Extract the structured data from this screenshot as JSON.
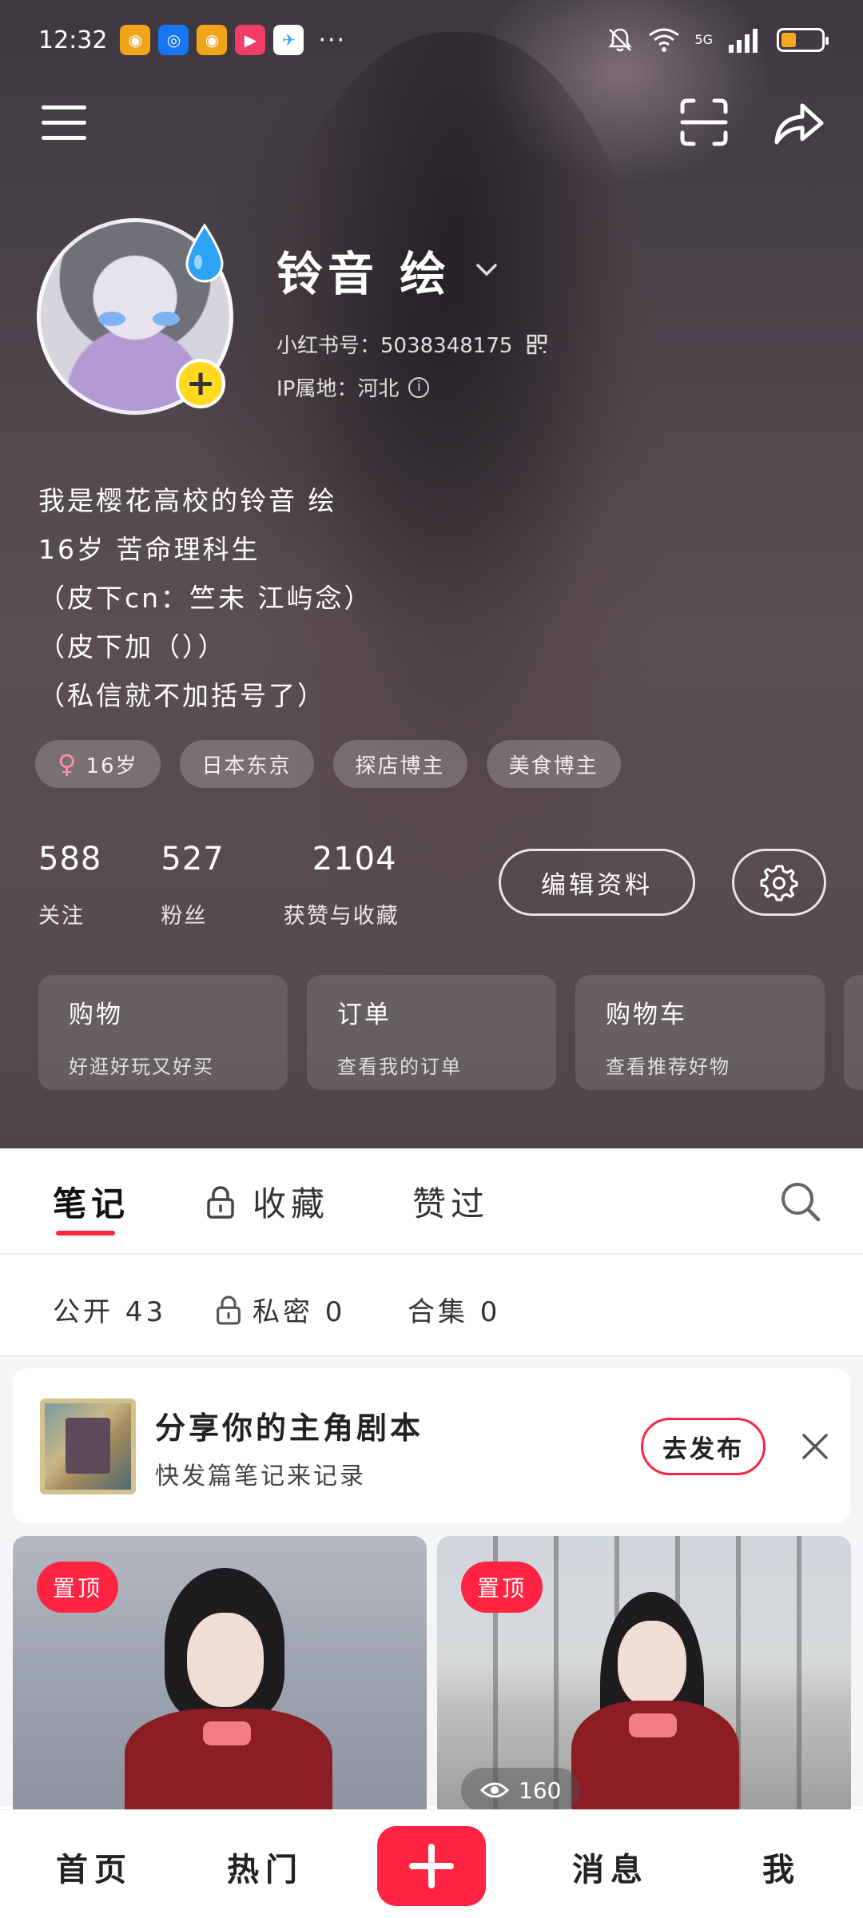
{
  "status_bar": {
    "time": "12:32",
    "more": "···",
    "network": "5G",
    "apps": [
      {
        "icon": "weibo-icon",
        "color": "#f0a419"
      },
      {
        "icon": "browser-icon",
        "color": "#1676f3"
      },
      {
        "icon": "weibo-icon",
        "color": "#f0a419"
      },
      {
        "icon": "video-app-icon",
        "color": "#ef3d67"
      },
      {
        "icon": "messenger-icon",
        "color": "#ffffff"
      }
    ]
  },
  "profile": {
    "name": "铃音 绘",
    "id_text": "小红书号：5038348175",
    "ip_text": "IP属地：河北",
    "bio": [
      "我是樱花高校的铃音 绘",
      "16岁 苦命理科生",
      "（皮下cn：竺未 江屿念）",
      "（皮下加（））",
      "（私信就不加括号了）"
    ],
    "tags": [
      "16岁",
      "日本东京",
      "探店博主",
      "美食博主"
    ],
    "stats": [
      {
        "value": "588",
        "label": "关注"
      },
      {
        "value": "527",
        "label": "粉丝"
      },
      {
        "value": "2104",
        "label": "获赞与收藏"
      }
    ],
    "edit_label": "编辑资料"
  },
  "shop_cards": [
    {
      "title": "购物",
      "subtitle": "好逛好玩又好买"
    },
    {
      "title": "订单",
      "subtitle": "查看我的订单"
    },
    {
      "title": "购物车",
      "subtitle": "查看推荐好物"
    }
  ],
  "tabs": {
    "notes": "笔记",
    "collections": "收藏",
    "liked": "赞过"
  },
  "subtabs": {
    "public": "公开 43",
    "private": "私密 0",
    "albums": "合集 0"
  },
  "promo": {
    "title": "分享你的主角剧本",
    "subtitle": "快发篇笔记来记录",
    "button": "去发布"
  },
  "notes": [
    {
      "badge": "置顶"
    },
    {
      "badge": "置顶",
      "views": "160"
    }
  ],
  "bottom_nav": {
    "home": "首页",
    "hot": "热门",
    "messages": "消息",
    "me": "我"
  },
  "colors": {
    "accent": "#ff2442",
    "avatar_add": "#ffd81f"
  }
}
